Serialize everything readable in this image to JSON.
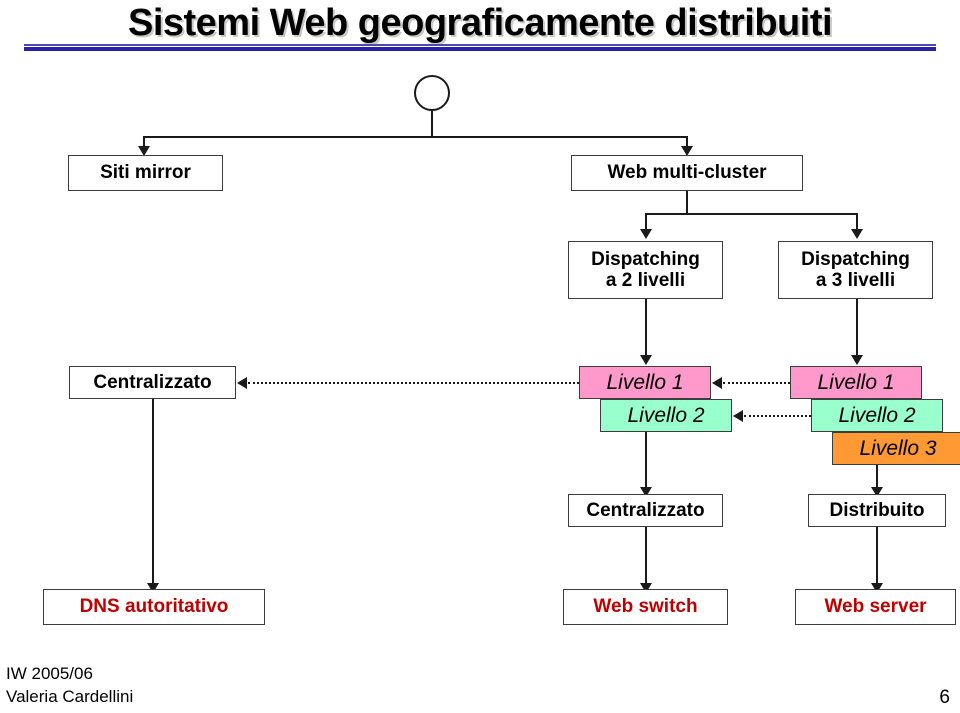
{
  "slide": {
    "title": "Sistemi Web geograficamente distribuiti",
    "page_number": "6",
    "footer_course": "IW 2005/06",
    "footer_author": "Valeria Cardellini",
    "accent_rule_color": "#2b21a8",
    "red_text_color": "#c00000"
  },
  "diagram": {
    "root_node_label": "",
    "nodes": {
      "siti_mirror": "Siti mirror",
      "web_multicluster": "Web multi-cluster",
      "dispatching_2": "Dispatching\na 2 livelli",
      "dispatching_3": "Dispatching\na 3 livelli",
      "centralizzato_left": "Centralizzato",
      "livello1_mid": "Livello 1",
      "livello2_mid": "Livello 2",
      "livello1_right": "Livello 1",
      "livello2_right": "Livello 2",
      "livello3_right": "Livello 3",
      "centralizzato_mid": "Centralizzato",
      "distribuito_right": "Distribuito",
      "dns_autoritativo": "DNS autoritativo",
      "web_switch": "Web switch",
      "web_server": "Web server"
    },
    "colors": {
      "livello1": "#ff99cc",
      "livello2": "#99ffcc",
      "livello3": "#ff9933",
      "box_border": "#3d3d3d",
      "connector": "#1a1a1a"
    }
  }
}
